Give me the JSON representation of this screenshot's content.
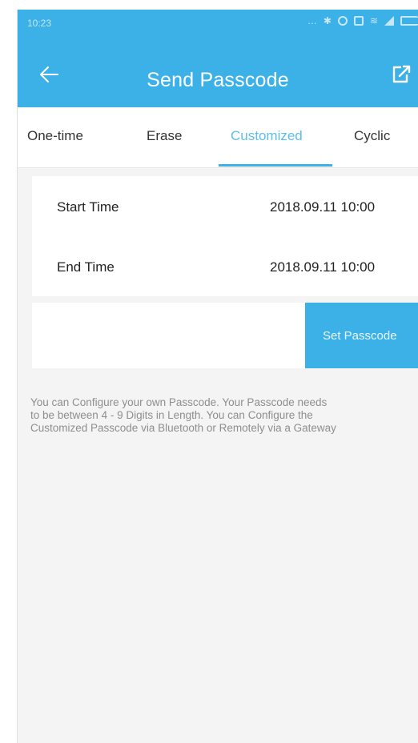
{
  "status_bar": {
    "time": "10:23",
    "icons": [
      "more-icon",
      "bluetooth-icon",
      "alarm-icon",
      "vibrate-icon",
      "wifi-icon",
      "signal-icon",
      "battery-icon"
    ]
  },
  "header": {
    "title": "Send Passcode",
    "back_icon": "arrow-left-icon",
    "action_icon": "share-icon"
  },
  "tabs": [
    {
      "label": "One-time",
      "active": false
    },
    {
      "label": "Erase",
      "active": false
    },
    {
      "label": "Customized",
      "active": true
    },
    {
      "label": "Cyclic",
      "active": false
    }
  ],
  "time_settings": {
    "start": {
      "label": "Start Time",
      "value": "2018.09.11 10:00"
    },
    "end": {
      "label": "End Time",
      "value": "2018.09.11 10:00"
    }
  },
  "action": {
    "set_passcode_label": "Set Passcode"
  },
  "help_text": [
    "You can Configure your own Passcode. Your Passcode needs",
    "to be between 4 - 9 Digits in Length. You can Configure the",
    "Customized Passcode via Bluetooth or Remotely via a Gateway"
  ],
  "colors": {
    "accent": "#3bb1e8",
    "active_tab_text": "#5cbfea",
    "background": "#f4f4f4"
  }
}
